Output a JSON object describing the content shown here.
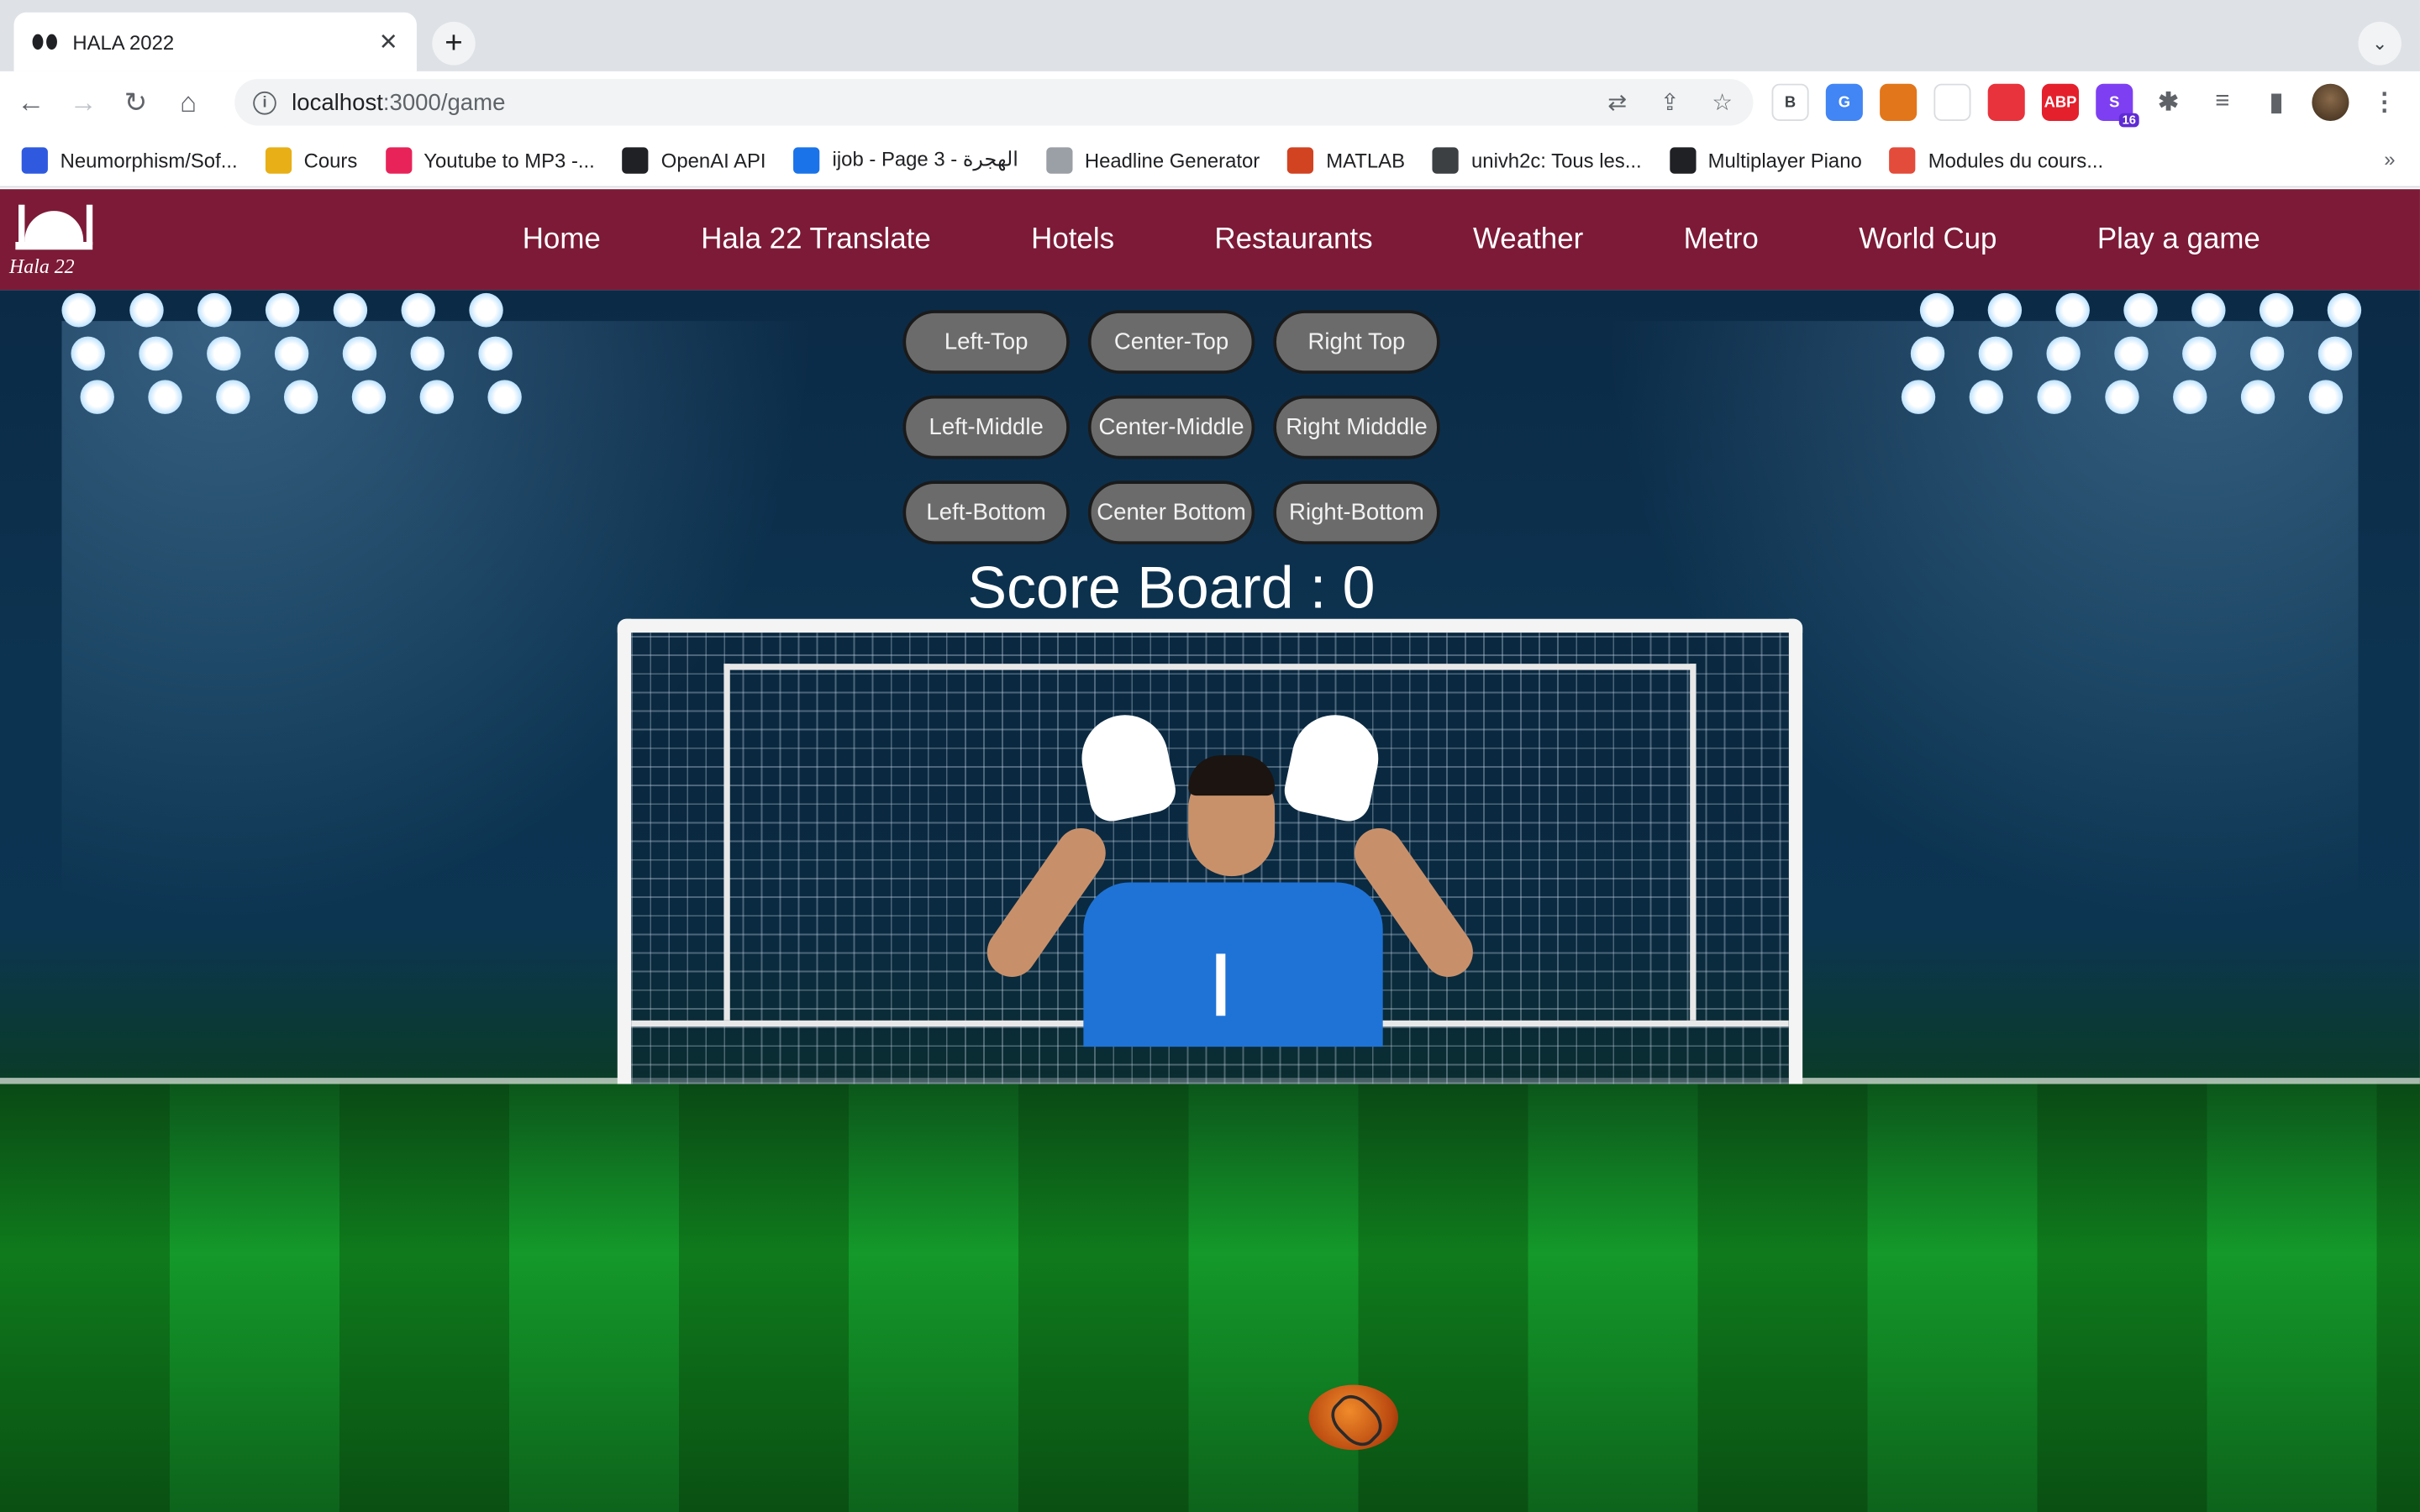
{
  "browser": {
    "tab_title": "HALA 2022",
    "url_host": "localhost",
    "url_rest": ":3000/game",
    "extension_badge": "16",
    "extensions": [
      {
        "icon": "bitwarden-icon",
        "label": "B",
        "color": "#ffffff"
      },
      {
        "icon": "translate-icon",
        "label": "G",
        "color": "#4285f4"
      },
      {
        "icon": "metamask-icon",
        "label": "",
        "color": "#e2761b"
      },
      {
        "icon": "scope-icon",
        "label": "",
        "color": "#ffffff"
      },
      {
        "icon": "red-ext-icon",
        "label": "",
        "color": "#e8323c"
      },
      {
        "icon": "adblock-icon",
        "label": "ABP",
        "color": "#e4202c"
      },
      {
        "icon": "s-ext-icon",
        "label": "S",
        "color": "#7e3ff2"
      }
    ]
  },
  "bookmarks": [
    {
      "label": "Neumorphism/Sof...",
      "color": "#2f5ae0"
    },
    {
      "label": "Cours",
      "color": "#e8b016"
    },
    {
      "label": "Youtube to MP3 -...",
      "color": "#e8235a"
    },
    {
      "label": "OpenAI API",
      "color": "#202124"
    },
    {
      "label": "ijob - Page 3 - الهجرة",
      "color": "#1a73e8"
    },
    {
      "label": "Headline Generator",
      "color": "#9aa0a6"
    },
    {
      "label": "MATLAB",
      "color": "#d14321"
    },
    {
      "label": "univh2c: Tous les...",
      "color": "#3c4043"
    },
    {
      "label": "Multiplayer Piano",
      "color": "#202124"
    },
    {
      "label": "Modules du cours...",
      "color": "#e34b3a"
    }
  ],
  "site": {
    "logo_text": "Hala 22",
    "nav": [
      "Home",
      "Hala 22 Translate",
      "Hotels",
      "Restaurants",
      "Weather",
      "Metro",
      "World Cup",
      "Play a game"
    ],
    "brand_color": "#7c1a37"
  },
  "game": {
    "shots": [
      "Left-Top",
      "Center-Top",
      "Right Top",
      "Left-Middle",
      "Center-Middle",
      "Right Midddle",
      "Left-Bottom",
      "Center Bottom",
      "Right-Bottom"
    ],
    "score_label": "Score Board : 0"
  }
}
